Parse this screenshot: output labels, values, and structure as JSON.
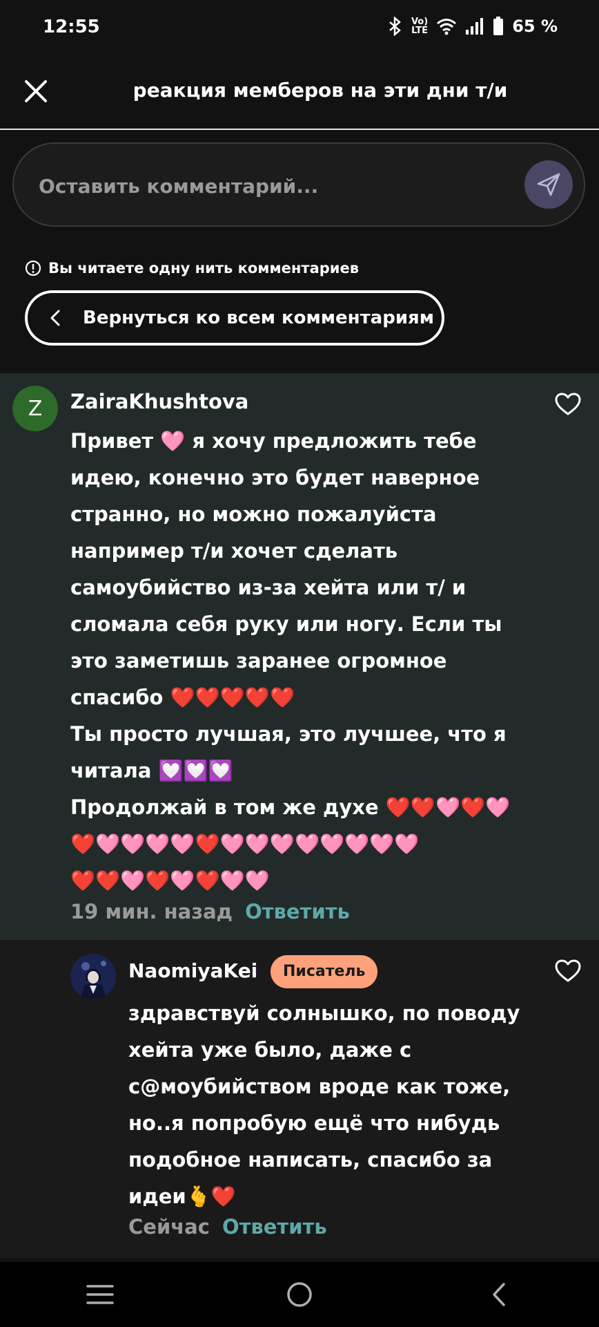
{
  "status_bar": {
    "time": "12:55",
    "battery": "65 %",
    "network": "LTE"
  },
  "header": {
    "title": "реакция мемберов на эти дни т/и"
  },
  "comment_input": {
    "placeholder": "Оставить комментарий..."
  },
  "thread": {
    "notice": "Вы читаете одну нить комментариев",
    "back_label": "Вернуться ко всем комментариям"
  },
  "comments": [
    {
      "avatar_letter": "Z",
      "avatar_color": "#2e6a2a",
      "author": "ZairaKhushtova",
      "text": "Привет 🩷 я хочу предложить тебе\nидею, конечно это будет наверное\nстранно, но можно пожалуйста\nнапример т/и хочет сделать\nсамоубийство из-за хейта или т/ и\nсломала себя руку или ногу. Если ты\nэто заметишь заранее огромное\nспасибо ❤️❤️❤️❤️❤️\nТы просто лучшая, это лучшее, что я\nчитала 💟💟💟\nПродолжай в том же духе ❤️❤️🩷❤️🩷\n❤️🩷🩷🩷🩷❤️🩷🩷🩷🩷🩷🩷🩷🩷\n❤️❤️🩷❤️🩷❤️🩷🩷",
      "time": "19 мин. назад",
      "reply_label": "Ответить"
    },
    {
      "author": "NaomiyaKei",
      "badge": "Писатель",
      "badge_color": "#ffa27c",
      "text": "здравствуй солнышко, по поводу\nхейта уже было, даже с\nс@моубийством вроде как тоже,\nно..я попробую ещё что нибудь\nподобное написать, спасибо за\nидеи🫰❤️",
      "time": "Сейчас",
      "reply_label": "Ответить"
    }
  ],
  "icons": {
    "close": "close-icon",
    "send": "send-icon",
    "info": "info-icon",
    "back": "chevron-left-icon",
    "like": "heart-outline-icon",
    "nav_menu": "menu-icon",
    "nav_home": "home-circle-icon",
    "nav_back": "back-icon"
  },
  "colors": {
    "background": "#121212",
    "comment_bg": "#222a2a",
    "reply_link": "#5fa8a8",
    "send_button": "#4a4766"
  }
}
